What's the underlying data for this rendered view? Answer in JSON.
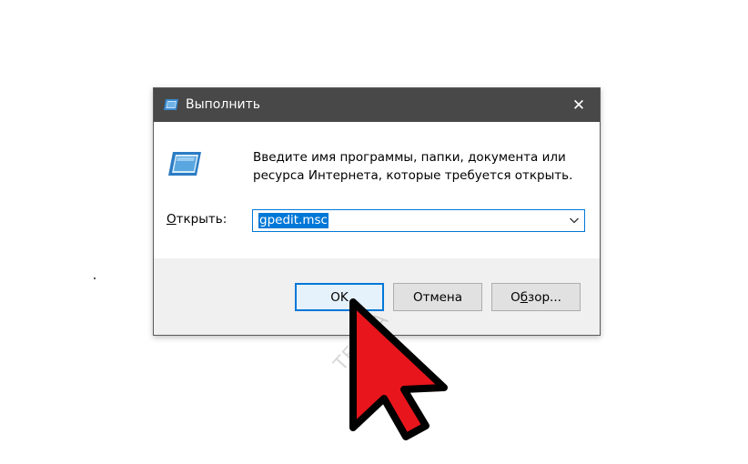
{
  "dialog": {
    "title": "Выполнить",
    "close_glyph": "✕",
    "prompt": "Введите имя программы, папки, документа или ресурса Интернета, которые требуется открыть.",
    "open_label_ul": "О",
    "open_label_rest": "ткрыть:",
    "open_value": "gpedit.msc",
    "ok_label": "OK",
    "cancel_label": "Отмена",
    "browse_label_ul": "б",
    "browse_label_pre": "О",
    "browse_label_post": "зор..."
  },
  "watermark": "TEHDA",
  "colors": {
    "titlebar": "#484848",
    "accent": "#0078d7",
    "footer": "#f0f0f0",
    "cursor_fill": "#e8161c"
  },
  "icons": {
    "app": "run-icon",
    "close": "close-icon",
    "dropdown": "chevron-down-icon",
    "pointer": "mouse-cursor-icon"
  }
}
